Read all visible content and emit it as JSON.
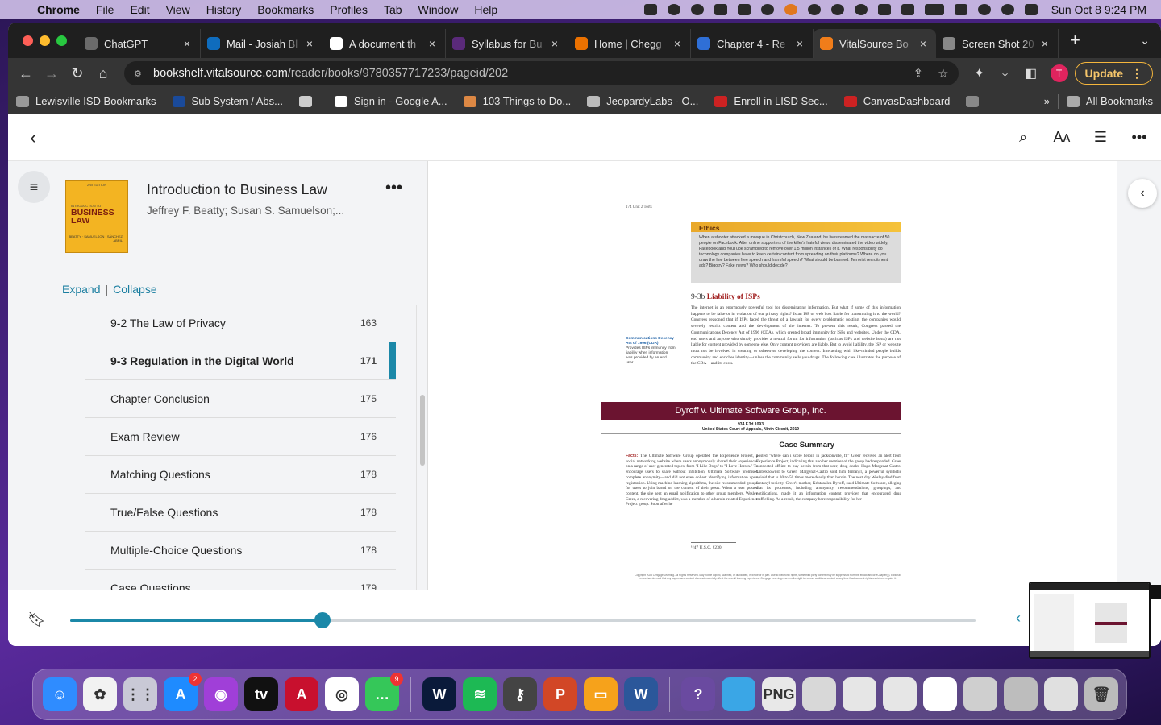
{
  "menubar": {
    "app": "Chrome",
    "items": [
      "File",
      "Edit",
      "View",
      "History",
      "Bookmarks",
      "Profiles",
      "Tab",
      "Window",
      "Help"
    ],
    "clock": "Sun Oct 8  9:24 PM"
  },
  "tabs": [
    {
      "title": "ChatGPT",
      "color": "#6b6b6b"
    },
    {
      "title": "Mail - Josiah Bl",
      "color": "#0f6cbd"
    },
    {
      "title": "A document th",
      "color": "#ffffff"
    },
    {
      "title": "Syllabus for Bu",
      "color": "#5a2a7a"
    },
    {
      "title": "Home | Chegg",
      "color": "#eb7100"
    },
    {
      "title": "Chapter 4 - Re",
      "color": "#2f6fd6"
    },
    {
      "title": "VitalSource Bo",
      "color": "#f07d1a",
      "active": true
    },
    {
      "title": "Screen Shot 20",
      "color": "#888888"
    }
  ],
  "omnibox": {
    "host": "bookshelf.vitalsource.com",
    "path": "/reader/books/9780357717233/pageid/202"
  },
  "profile_initial": "T",
  "update_label": "Update",
  "bookmarks": [
    {
      "label": "Lewisville ISD Bookmarks",
      "color": "#999999"
    },
    {
      "label": "Sub System / Abs...",
      "color": "#1a4a9a"
    },
    {
      "label": "",
      "color": "#cccccc"
    },
    {
      "label": "Sign in - Google A...",
      "color": "#ffffff"
    },
    {
      "label": "103 Things to Do...",
      "color": "#d84"
    },
    {
      "label": "JeopardyLabs - O...",
      "color": "#bbb"
    },
    {
      "label": "Enroll in LISD Sec...",
      "color": "#c22"
    },
    {
      "label": "CanvasDashboard",
      "color": "#c22"
    },
    {
      "label": "",
      "color": "#888"
    }
  ],
  "bookmarks_overflow": "»",
  "all_bookmarks": "All Bookmarks",
  "book": {
    "cover_edition": "2nd EDITION",
    "cover_series": "INTRODUCTION TO",
    "cover_title_1": "BUSINESS",
    "cover_title_2": "LAW",
    "cover_authors": "BEATTY · SAMUELSON · SÁNCHEZ ABRIL",
    "title": "Introduction to Business Law",
    "authors": "Jeffrey F. Beatty; Susan S. Samuelson;..."
  },
  "toc_controls": {
    "expand": "Expand",
    "separator": "|",
    "collapse": "Collapse"
  },
  "toc": [
    {
      "label": "9-2 The Law of Privacy",
      "page": "163"
    },
    {
      "label": "9-3 Regulation in the Digital World",
      "page": "171",
      "current": true
    },
    {
      "label": "Chapter Conclusion",
      "page": "175"
    },
    {
      "label": "Exam Review",
      "page": "176"
    },
    {
      "label": "Matching Questions",
      "page": "178"
    },
    {
      "label": "True/False Questions",
      "page": "178"
    },
    {
      "label": "Multiple-Choice Questions",
      "page": "178"
    },
    {
      "label": "Case Questions",
      "page": "179"
    }
  ],
  "page": {
    "running_head": "174        Unit 2   Torts",
    "ethics_title": "Ethics",
    "ethics_text": "When a shooter attacked a mosque in Christchurch, New Zealand, he livestreamed the massacre of 50 people on Facebook. After online supporters of the killer's hateful views disseminated the video widely, Facebook and YouTube scrambled to remove over 1.5 million instances of it. What responsibility do technology companies have to keep certain content from spreading on their platforms? Where do you draw the line between free speech and harmful speech? What should be banned: Terrorist recruitment ads? Bigotry? Fake news? Who should decide?",
    "section_num": "9-3b",
    "section_title": "Liability of ISPs",
    "body": "The internet is an enormously powerful tool for disseminating information. But what if some of this information happens to be false or in violation of our privacy rights? Is an ISP or web host liable for transmitting it to the world? Congress reasoned that if ISPs faced the threat of a lawsuit for every problematic posting, the companies would severely restrict content and the development of the internet. To prevent this result, Congress passed the Communications Decency Act of 1996 (CDA), which created broad immunity for ISPs and websites. Under the CDA, end users and anyone who simply provides a neutral forum for information (such as ISPs and website hosts) are not liable for content provided by someone else. Only content providers are liable. But to avoid liability, the ISP or website must not be involved in creating or otherwise developing the content. Interacting with like-minded people builds community and enriches identity—unless the community sells you drugs. The following case illustrates the purpose of the CDA—and its costs.",
    "margin_title": "Communications Decency Act of 1996 (CDA)",
    "margin_text": "Provides ISPs immunity from liability when information was provided by an end user.",
    "case_name": "Dyroff v. Ultimate Software Group, Inc.",
    "case_cite_1": "934 F.3d 1093",
    "case_cite_2": "United States Court of Appeals, Ninth Circuit, 2019",
    "case_summary": "Case Summary",
    "facts_label": "Facts:",
    "col1": "The Ultimate Software Group operated the Experience Project, a social networking website where users anonymously shared their experiences on a range of user-generated topics, from \"I Like Dogs\" to \"I Love Heroin.\" To encourage users to share without inhibition, Ultimate Software promised complete anonymity—and did not even collect identifying information upon registration. Using machine-learning algorithms, the site recommended groups for users to join based on the content of their posts. When a user posted content, the site sent an email notification to other group members. Wesley Greer, a recovering drug addict, was a member of a heroin-related Experience Project group. Soon after he",
    "col2": "posted \"where can i score heroin in jacksonville, fl,\" Greer received an alert from Experience Project, indicating that another member of the group had responded. Greer connected offline to buy heroin from that user, drug dealer Hugo Margenat-Castro. Unbeknownst to Greer, Margenat-Castro sold him fentanyl, a powerful synthetic opioid that is 30 to 50 times more deadly than heroin. The next day Wesley died from fentanyl toxicity. Greer's mother, Kristanalea Dyroff, sued Ultimate Software, alleging that its processes, including anonymity, recommendations, groupings, and notifications, made it an information content provider that encouraged drug trafficking. As a result, the company bore responsibility for her",
    "footnote": "¹⁸47 U.S.C. §230.",
    "copyright": "Copyright 2023 Cengage Learning. All Rights Reserved. May not be copied, scanned, or duplicated, in whole or in part. Due to electronic rights, some third party content may be suppressed from the eBook and/or eChapter(s). Editorial review has deemed that any suppressed content does not materially affect the overall learning experience. Cengage Learning reserves the right to remove additional content at any time if subsequent rights restrictions require it."
  },
  "progress": {
    "fraction": 0.279
  },
  "dock": [
    {
      "name": "finder",
      "color": "#2f8cff",
      "glyph": "☺"
    },
    {
      "name": "photos-app",
      "color": "#f2f2f2",
      "glyph": "✿"
    },
    {
      "name": "launchpad",
      "color": "#c9c9d6",
      "glyph": "⋮⋮"
    },
    {
      "name": "app-store",
      "color": "#1e8bff",
      "glyph": "A",
      "badge": "2"
    },
    {
      "name": "podcasts",
      "color": "#a03fd8",
      "glyph": "◉"
    },
    {
      "name": "apple-tv",
      "color": "#111111",
      "glyph": "tv"
    },
    {
      "name": "acrobat",
      "color": "#c8102e",
      "glyph": "A"
    },
    {
      "name": "chrome",
      "color": "#ffffff",
      "glyph": "◎"
    },
    {
      "name": "messages",
      "color": "#35c759",
      "glyph": "…",
      "badge": "9"
    },
    {
      "name": "webex",
      "color": "#0a1a3a",
      "glyph": "W"
    },
    {
      "name": "spotify",
      "color": "#1db954",
      "glyph": "≋"
    },
    {
      "name": "keychain",
      "color": "#444444",
      "glyph": "⚷"
    },
    {
      "name": "powerpoint",
      "color": "#d24726",
      "glyph": "P"
    },
    {
      "name": "keynote",
      "color": "#f6a21b",
      "glyph": "▭"
    },
    {
      "name": "word",
      "color": "#2b579a",
      "glyph": "W"
    },
    {
      "name": "help",
      "color": "#6a4aa0",
      "glyph": "?"
    },
    {
      "name": "folder",
      "color": "#3aa6e6",
      "glyph": ""
    },
    {
      "name": "png-file",
      "color": "#e8e8e8",
      "glyph": "PNG"
    },
    {
      "name": "recent-1",
      "color": "#d8d8d8",
      "glyph": ""
    },
    {
      "name": "recent-2",
      "color": "#e6e6e6",
      "glyph": ""
    },
    {
      "name": "recent-3",
      "color": "#e6e6e6",
      "glyph": ""
    },
    {
      "name": "recent-4",
      "color": "#ffffff",
      "glyph": ""
    },
    {
      "name": "recent-5",
      "color": "#cfcfcf",
      "glyph": ""
    },
    {
      "name": "recent-6",
      "color": "#bdbdbd",
      "glyph": ""
    },
    {
      "name": "recent-7",
      "color": "#e0e0e0",
      "glyph": ""
    },
    {
      "name": "trash",
      "color": "#bbbbbb",
      "glyph": "🗑"
    }
  ]
}
